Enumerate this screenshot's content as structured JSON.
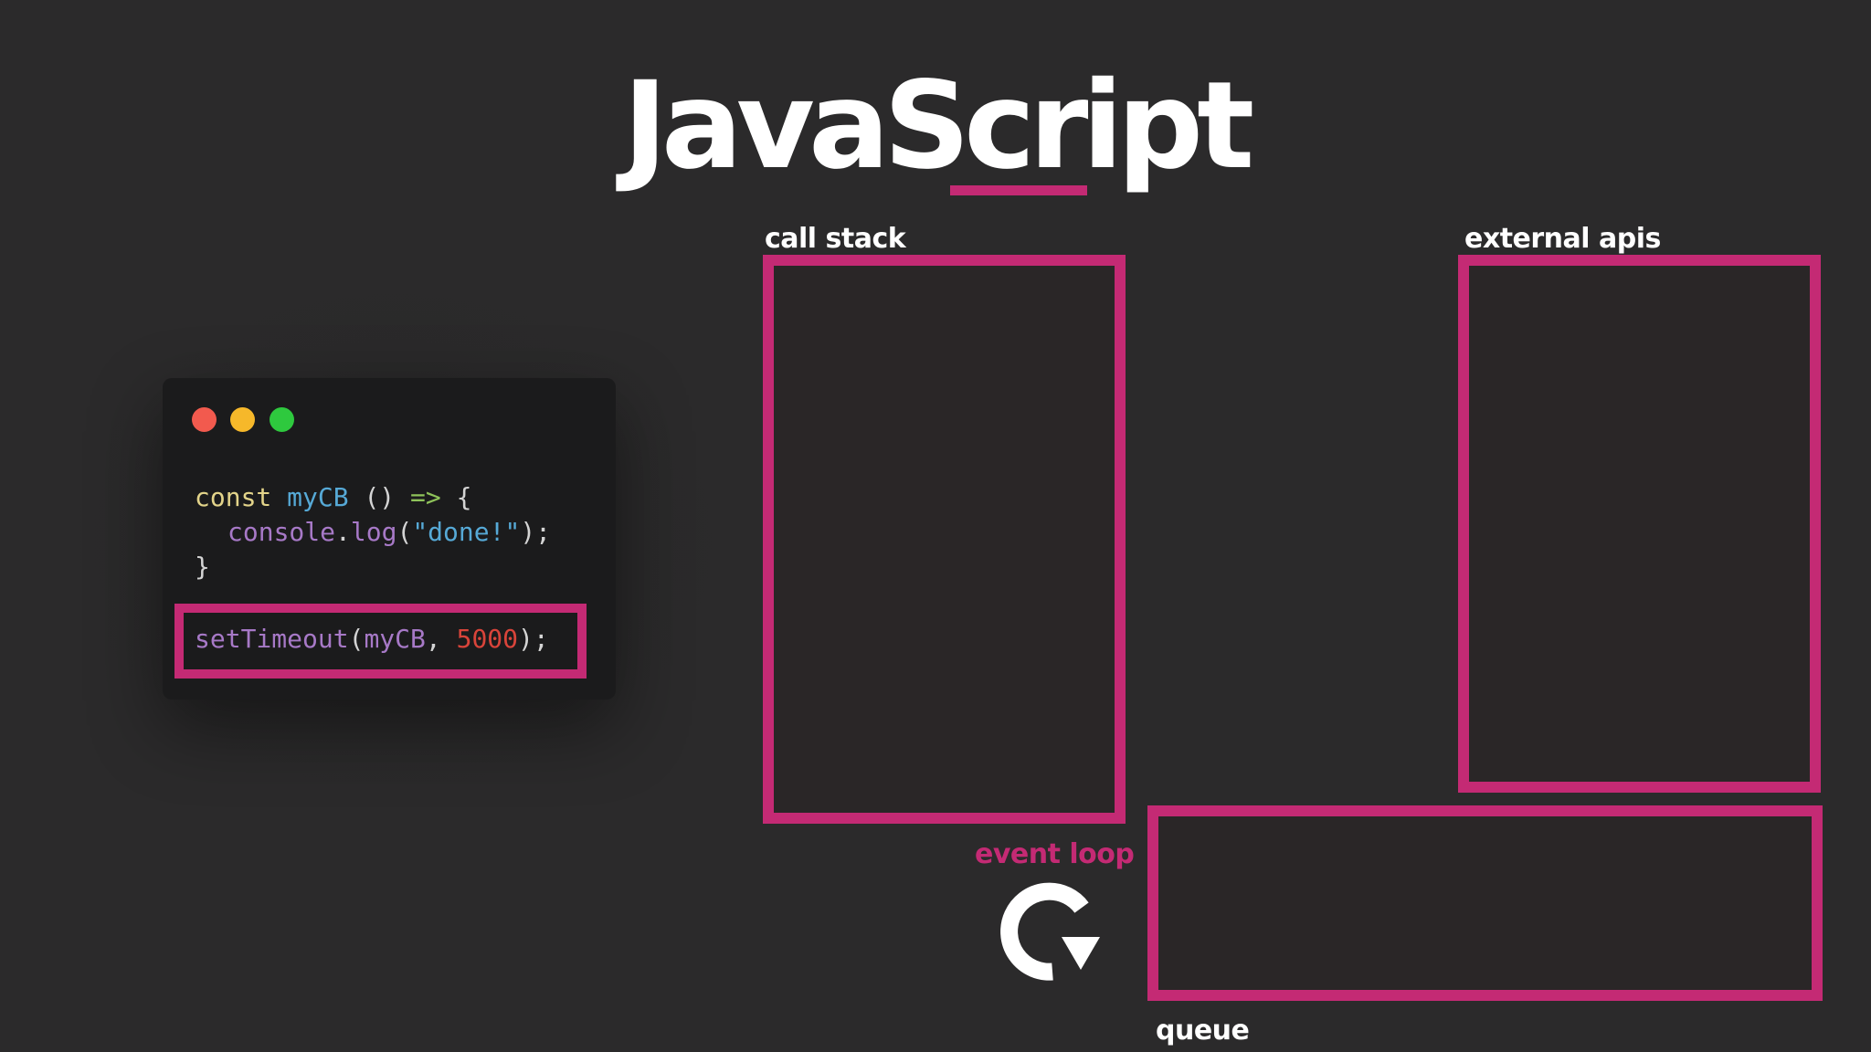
{
  "slide": {
    "title": "JavaScript"
  },
  "code": {
    "line1": {
      "keyword": "const",
      "name": "myCB",
      "parens": " ()",
      "arrow": "=>",
      "brace": "{"
    },
    "line2": {
      "object": "console",
      "dot": ".",
      "method": "log",
      "open": "(",
      "string": "\"done!\"",
      "close": ");"
    },
    "line3": {
      "brace": "}"
    },
    "line4": {
      "func": "setTimeout",
      "open": "(",
      "arg": "myCB",
      "comma": ",",
      "number": "5000",
      "close": ");"
    }
  },
  "diagram": {
    "call_stack_label": "call stack",
    "external_apis_label": "external apis",
    "event_loop_label": "event loop",
    "queue_label": "queue"
  },
  "colors": {
    "accent": "#c42a74",
    "background": "#2b2a2b",
    "code_background": "#1b1b1c",
    "dot_red": "#f25a4e",
    "dot_yellow": "#f6b82a",
    "dot_green": "#2ec93e",
    "code_keyword": "#e3d48a",
    "code_name": "#56a9d6",
    "code_arrow": "#8fc35a",
    "code_member": "#a779c7",
    "code_string": "#56a9d6",
    "code_number": "#d9443a"
  },
  "icons": {
    "event_loop_icon": "circular-arrow-icon"
  }
}
